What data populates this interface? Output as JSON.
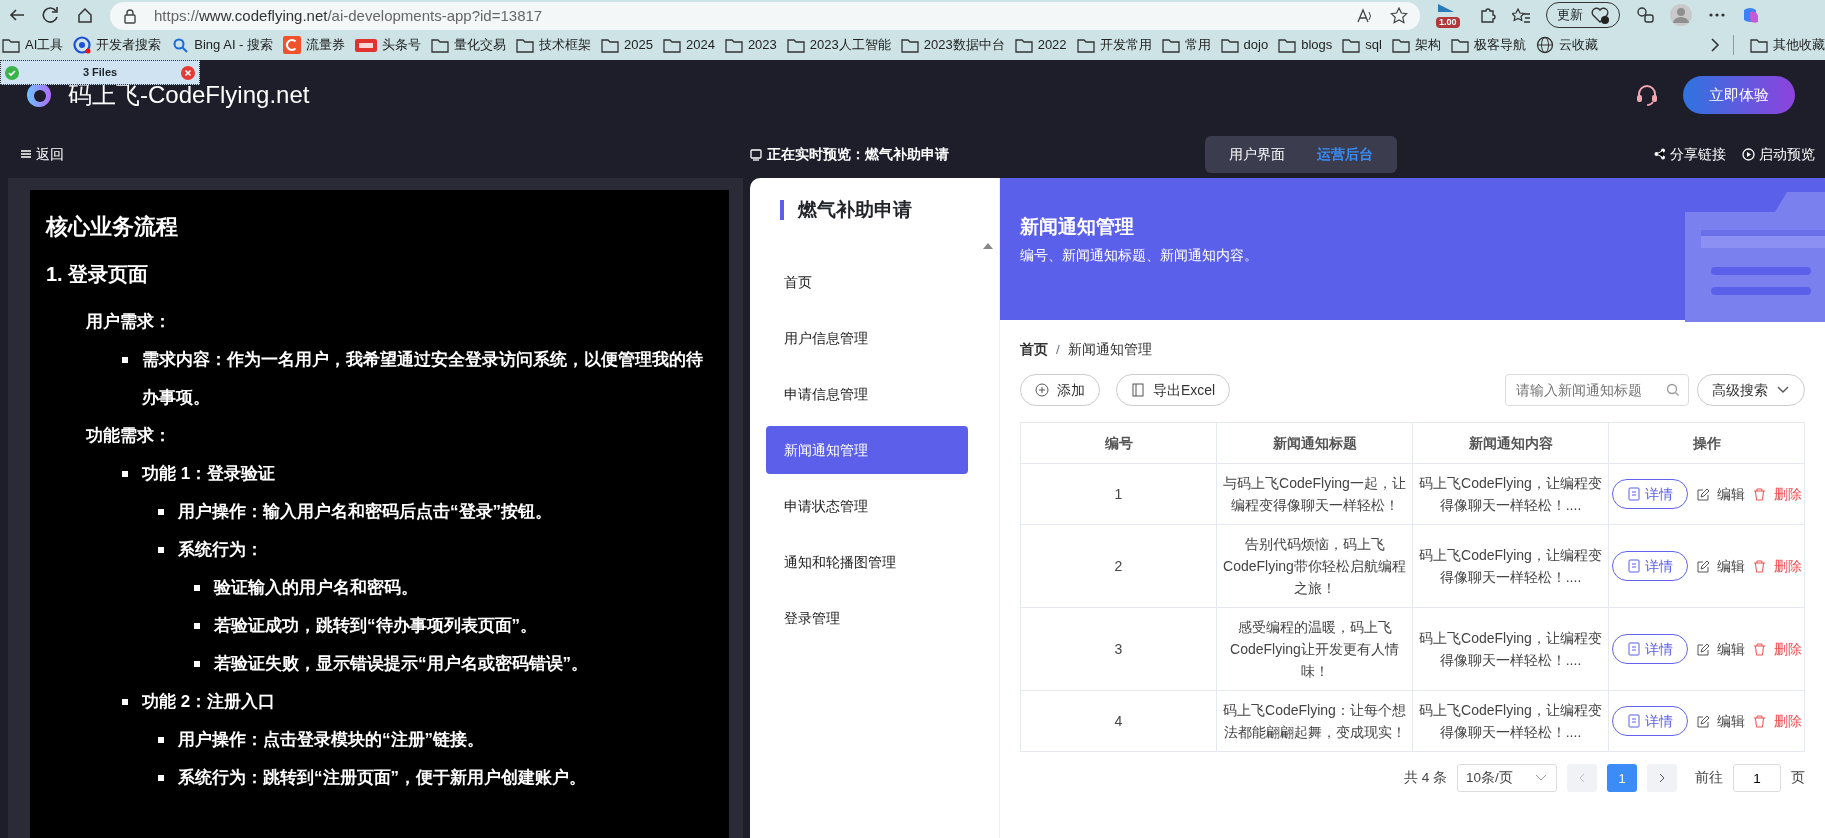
{
  "browser": {
    "url": {
      "scheme": "https://",
      "host": "www.codeflying.net",
      "path": "/ai-developments-app?id=13817"
    },
    "extension_badge": "1.00",
    "update_button": "更新"
  },
  "bookmarks": [
    {
      "label": "AI工具",
      "kind": "folder"
    },
    {
      "label": "开发者搜索",
      "kind": "target"
    },
    {
      "label": "Bing AI - 搜索",
      "kind": "search"
    },
    {
      "label": "流量券",
      "kind": "c-logo"
    },
    {
      "label": "头条号",
      "kind": "tile"
    },
    {
      "label": "量化交易",
      "kind": "folder"
    },
    {
      "label": "技术框架",
      "kind": "folder"
    },
    {
      "label": "2025",
      "kind": "folder"
    },
    {
      "label": "2024",
      "kind": "folder"
    },
    {
      "label": "2023",
      "kind": "folder"
    },
    {
      "label": "2023人工智能",
      "kind": "folder"
    },
    {
      "label": "2023数据中台",
      "kind": "folder"
    },
    {
      "label": "2022",
      "kind": "folder"
    },
    {
      "label": "开发常用",
      "kind": "folder"
    },
    {
      "label": "常用",
      "kind": "folder"
    },
    {
      "label": "dojo",
      "kind": "folder"
    },
    {
      "label": "blogs",
      "kind": "folder"
    },
    {
      "label": "sql",
      "kind": "folder"
    },
    {
      "label": "架构",
      "kind": "folder"
    },
    {
      "label": "极客导航",
      "kind": "folder"
    },
    {
      "label": "云收藏",
      "kind": "globe"
    }
  ],
  "other_bookmarks": "其他收藏",
  "download_popup": {
    "label": "3 Files"
  },
  "header": {
    "site_title": "码上飞-CodeFlying.net",
    "cta_button": "立即体验"
  },
  "subbar": {
    "back": "返回",
    "preview_label": "正在实时预览：燃气补助申请",
    "tabs": [
      {
        "label": "用户界面",
        "selected": false
      },
      {
        "label": "运营后台",
        "selected": true
      }
    ],
    "share": "分享链接",
    "launch": "启动预览"
  },
  "doc": {
    "title": "核心业务流程",
    "heading": "1. 登录页面",
    "blocks": [
      {
        "label": "用户需求：",
        "items": [
          {
            "text": "需求内容：作为一名用户，我希望通过安全登录访问系统，以便管理我的待办事项。"
          }
        ]
      },
      {
        "label": "功能需求：",
        "items": [
          {
            "text": "功能 1：登录验证",
            "children": [
              {
                "text": "用户操作：输入用户名和密码后点击“登录”按钮。"
              },
              {
                "text": "系统行为：",
                "children": [
                  {
                    "text": "验证输入的用户名和密码。"
                  },
                  {
                    "text": "若验证成功，跳转到“待办事项列表页面”。"
                  },
                  {
                    "text": "若验证失败，显示错误提示“用户名或密码错误”。"
                  }
                ]
              }
            ]
          },
          {
            "text": "功能 2：注册入口",
            "children": [
              {
                "text": "用户操作：点击登录模块的“注册”链接。"
              },
              {
                "text": "系统行为：跳转到“注册页面”，便于新用户创建账户。"
              }
            ]
          }
        ]
      }
    ]
  },
  "app": {
    "title": "燃气补助申请",
    "menu": [
      {
        "label": "首页",
        "selected": false
      },
      {
        "label": "用户信息管理",
        "selected": false
      },
      {
        "label": "申请信息管理",
        "selected": false
      },
      {
        "label": "新闻通知管理",
        "selected": true
      },
      {
        "label": "申请状态管理",
        "selected": false
      },
      {
        "label": "通知和轮播图管理",
        "selected": false
      },
      {
        "label": "登录管理",
        "selected": false
      }
    ],
    "banner": {
      "title": "新闻通知管理",
      "subtitle": "编号、新闻通知标题、新闻通知内容。"
    },
    "breadcrumb": [
      "首页",
      "/",
      "新闻通知管理"
    ],
    "toolbar": {
      "add": "添加",
      "export": "导出Excel",
      "search_placeholder": "请输入新闻通知标题",
      "advanced": "高级搜索"
    },
    "table": {
      "columns": [
        "编号",
        "新闻通知标题",
        "新闻通知内容",
        "操作"
      ],
      "rows": [
        {
          "id": "1",
          "title": "与码上飞CodeFlying一起，让编程变得像聊天一样轻松！",
          "content": "码上飞CodeFlying，让编程变得像聊天一样轻松！....",
          "actions": [
            "详情",
            "编辑",
            "删除"
          ]
        },
        {
          "id": "2",
          "title": "告别代码烦恼，码上飞CodeFlying带你轻松启航编程之旅！",
          "content": "码上飞CodeFlying，让编程变得像聊天一样轻松！....",
          "actions": [
            "详情",
            "编辑",
            "删除"
          ]
        },
        {
          "id": "3",
          "title": "感受编程的温暖，码上飞CodeFlying让开发更有人情味！",
          "content": "码上飞CodeFlying，让编程变得像聊天一样轻松！....",
          "actions": [
            "详情",
            "编辑",
            "删除"
          ]
        },
        {
          "id": "4",
          "title": "码上飞CodeFlying：让每个想法都能翩翩起舞，变成现实！",
          "content": "码上飞CodeFlying，让编程变得像聊天一样轻松！....",
          "actions": [
            "详情",
            "编辑",
            "删除"
          ]
        }
      ]
    },
    "pagination": {
      "total": "共 4 条",
      "page_size": "10条/页",
      "pages": [
        {
          "label": "1",
          "selected": true
        }
      ],
      "goto_label": "前往",
      "goto_value": "1",
      "goto_suffix": "页"
    }
  }
}
